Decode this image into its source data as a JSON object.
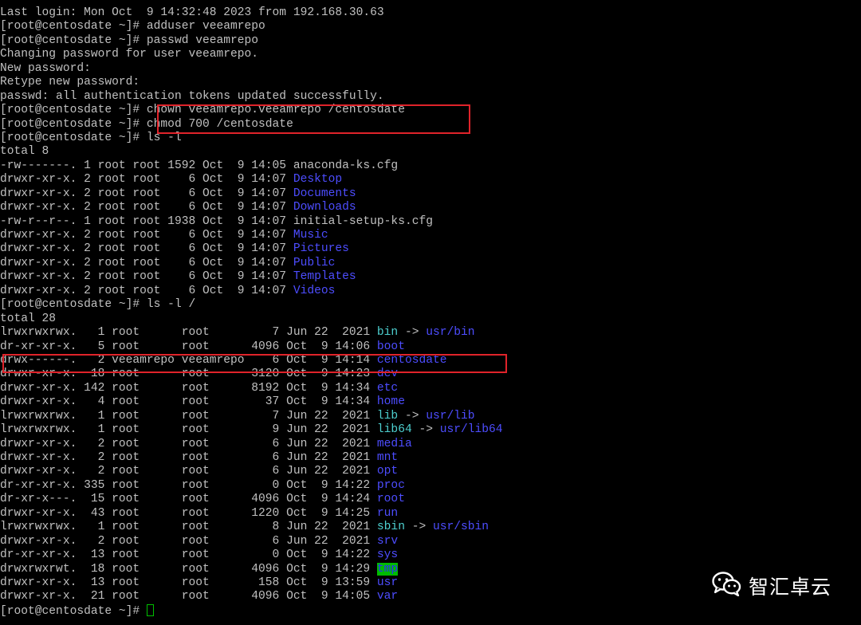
{
  "terminal": {
    "prompt": "[root@centosdate ~]# ",
    "lines": [
      [
        {
          "t": "Last login: Mon Oct  9 14:32:48 2023 from 192.168.30.63"
        }
      ],
      [
        {
          "t": "[root@centosdate ~]# adduser veeamrepo"
        }
      ],
      [
        {
          "t": "[root@centosdate ~]# passwd veeamrepo"
        }
      ],
      [
        {
          "t": "Changing password for user veeamrepo."
        }
      ],
      [
        {
          "t": "New password:"
        }
      ],
      [
        {
          "t": "Retype new password:"
        }
      ],
      [
        {
          "t": "passwd: all authentication tokens updated successfully."
        }
      ],
      [
        {
          "t": "[root@centosdate ~]# chown veeamrepo.veeamrepo /centosdate"
        }
      ],
      [
        {
          "t": "[root@centosdate ~]# chmod 700 /centosdate"
        }
      ],
      [
        {
          "t": "[root@centosdate ~]# ls -l"
        }
      ],
      [
        {
          "t": "total 8"
        }
      ],
      [
        {
          "t": "-rw-------. 1 root root 1592 Oct  9 14:05 anaconda-ks.cfg"
        }
      ],
      [
        {
          "t": "drwxr-xr-x. 2 root root    6 Oct  9 14:07 "
        },
        {
          "t": "Desktop",
          "c": "dir"
        }
      ],
      [
        {
          "t": "drwxr-xr-x. 2 root root    6 Oct  9 14:07 "
        },
        {
          "t": "Documents",
          "c": "dir"
        }
      ],
      [
        {
          "t": "drwxr-xr-x. 2 root root    6 Oct  9 14:07 "
        },
        {
          "t": "Downloads",
          "c": "dir"
        }
      ],
      [
        {
          "t": "-rw-r--r--. 1 root root 1938 Oct  9 14:07 initial-setup-ks.cfg"
        }
      ],
      [
        {
          "t": "drwxr-xr-x. 2 root root    6 Oct  9 14:07 "
        },
        {
          "t": "Music",
          "c": "dir"
        }
      ],
      [
        {
          "t": "drwxr-xr-x. 2 root root    6 Oct  9 14:07 "
        },
        {
          "t": "Pictures",
          "c": "dir"
        }
      ],
      [
        {
          "t": "drwxr-xr-x. 2 root root    6 Oct  9 14:07 "
        },
        {
          "t": "Public",
          "c": "dir"
        }
      ],
      [
        {
          "t": "drwxr-xr-x. 2 root root    6 Oct  9 14:07 "
        },
        {
          "t": "Templates",
          "c": "dir"
        }
      ],
      [
        {
          "t": "drwxr-xr-x. 2 root root    6 Oct  9 14:07 "
        },
        {
          "t": "Videos",
          "c": "dir"
        }
      ],
      [
        {
          "t": "[root@centosdate ~]# ls -l /"
        }
      ],
      [
        {
          "t": "total 28"
        }
      ],
      [
        {
          "t": "lrwxrwxrwx.   1 root      root         7 Jun 22  2021 "
        },
        {
          "t": "bin",
          "c": "link"
        },
        {
          "t": " -> "
        },
        {
          "t": "usr/bin",
          "c": "dir"
        }
      ],
      [
        {
          "t": "dr-xr-xr-x.   5 root      root      4096 Oct  9 14:06 "
        },
        {
          "t": "boot",
          "c": "dir"
        }
      ],
      [
        {
          "t": "drwx------.   2 veeamrepo veeamrepo    6 Oct  9 14:14 "
        },
        {
          "t": "centosdate",
          "c": "dir"
        }
      ],
      [
        {
          "t": "drwxr-xr-x.  18 root      root      3120 Oct  9 14:23 "
        },
        {
          "t": "dev",
          "c": "dir"
        }
      ],
      [
        {
          "t": "drwxr-xr-x. 142 root      root      8192 Oct  9 14:34 "
        },
        {
          "t": "etc",
          "c": "dir"
        }
      ],
      [
        {
          "t": "drwxr-xr-x.   4 root      root        37 Oct  9 14:34 "
        },
        {
          "t": "home",
          "c": "dir"
        }
      ],
      [
        {
          "t": "lrwxrwxrwx.   1 root      root         7 Jun 22  2021 "
        },
        {
          "t": "lib",
          "c": "link"
        },
        {
          "t": " -> "
        },
        {
          "t": "usr/lib",
          "c": "dir"
        }
      ],
      [
        {
          "t": "lrwxrwxrwx.   1 root      root         9 Jun 22  2021 "
        },
        {
          "t": "lib64",
          "c": "link"
        },
        {
          "t": " -> "
        },
        {
          "t": "usr/lib64",
          "c": "dir"
        }
      ],
      [
        {
          "t": "drwxr-xr-x.   2 root      root         6 Jun 22  2021 "
        },
        {
          "t": "media",
          "c": "dir"
        }
      ],
      [
        {
          "t": "drwxr-xr-x.   2 root      root         6 Jun 22  2021 "
        },
        {
          "t": "mnt",
          "c": "dir"
        }
      ],
      [
        {
          "t": "drwxr-xr-x.   2 root      root         6 Jun 22  2021 "
        },
        {
          "t": "opt",
          "c": "dir"
        }
      ],
      [
        {
          "t": "dr-xr-xr-x. 335 root      root         0 Oct  9 14:22 "
        },
        {
          "t": "proc",
          "c": "dir"
        }
      ],
      [
        {
          "t": "dr-xr-x---.  15 root      root      4096 Oct  9 14:24 "
        },
        {
          "t": "root",
          "c": "dir"
        }
      ],
      [
        {
          "t": "drwxr-xr-x.  43 root      root      1220 Oct  9 14:25 "
        },
        {
          "t": "run",
          "c": "dir"
        }
      ],
      [
        {
          "t": "lrwxrwxrwx.   1 root      root         8 Jun 22  2021 "
        },
        {
          "t": "sbin",
          "c": "link"
        },
        {
          "t": " -> "
        },
        {
          "t": "usr/sbin",
          "c": "dir"
        }
      ],
      [
        {
          "t": "drwxr-xr-x.   2 root      root         6 Jun 22  2021 "
        },
        {
          "t": "srv",
          "c": "dir"
        }
      ],
      [
        {
          "t": "dr-xr-xr-x.  13 root      root         0 Oct  9 14:22 "
        },
        {
          "t": "sys",
          "c": "dir"
        }
      ],
      [
        {
          "t": "drwxrwxrwt.  18 root      root      4096 Oct  9 14:29 "
        },
        {
          "t": "tmp",
          "c": "tmp"
        }
      ],
      [
        {
          "t": "drwxr-xr-x.  13 root      root       158 Oct  9 13:59 "
        },
        {
          "t": "usr",
          "c": "dir"
        }
      ],
      [
        {
          "t": "drwxr-xr-x.  21 root      root      4096 Oct  9 14:05 "
        },
        {
          "t": "var",
          "c": "dir"
        }
      ]
    ]
  },
  "colors": {
    "background": "#000000",
    "text": "#c0c0c0",
    "directory": "#4d4dff",
    "symlink": "#4dcfcf",
    "highlight_box": "#e0232a",
    "cursor": "#00c000"
  },
  "watermark": {
    "icon": "wechat-icon",
    "text": "智汇卓云"
  }
}
